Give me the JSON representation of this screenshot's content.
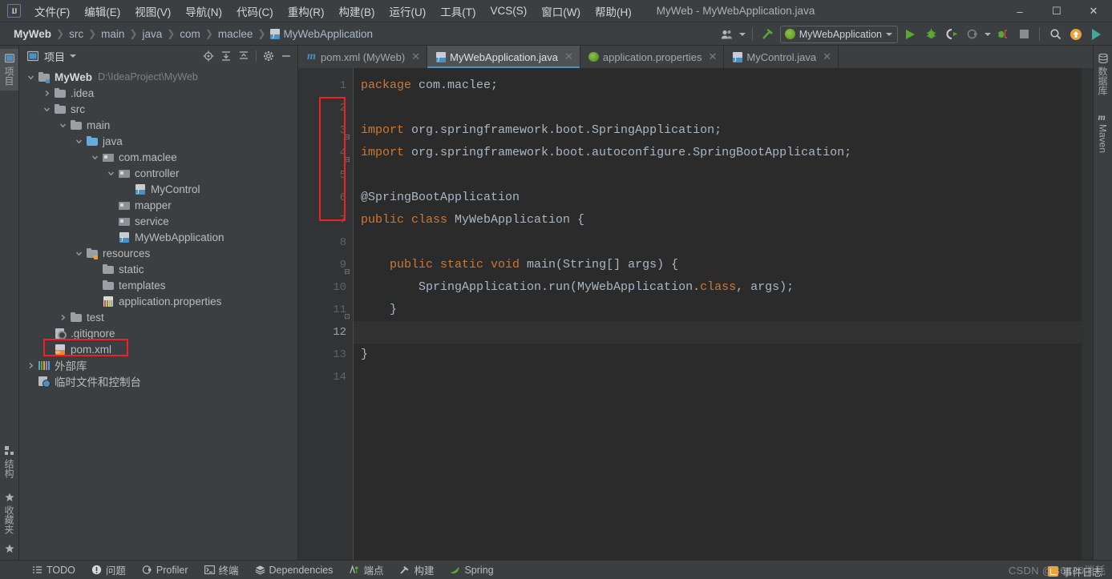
{
  "window": {
    "title": "MyWeb - MyWebApplication.java",
    "logo": "IJ",
    "controls": {
      "minimize": "–",
      "maximize": "☐",
      "close": "✕"
    }
  },
  "menubar": [
    {
      "label": "文件(F)",
      "name": "menu-file"
    },
    {
      "label": "编辑(E)",
      "name": "menu-edit"
    },
    {
      "label": "视图(V)",
      "name": "menu-view"
    },
    {
      "label": "导航(N)",
      "name": "menu-navigate"
    },
    {
      "label": "代码(C)",
      "name": "menu-code"
    },
    {
      "label": "重构(R)",
      "name": "menu-refactor"
    },
    {
      "label": "构建(B)",
      "name": "menu-build"
    },
    {
      "label": "运行(U)",
      "name": "menu-run"
    },
    {
      "label": "工具(T)",
      "name": "menu-tools"
    },
    {
      "label": "VCS(S)",
      "name": "menu-vcs"
    },
    {
      "label": "窗口(W)",
      "name": "menu-window"
    },
    {
      "label": "帮助(H)",
      "name": "menu-help"
    }
  ],
  "breadcrumb": [
    "MyWeb",
    "src",
    "main",
    "java",
    "com",
    "maclee",
    "MyWebApplication"
  ],
  "toolbar": {
    "run_config": "MyWebApplication",
    "buttons": [
      "run",
      "debug",
      "run-with-coverage",
      "profile",
      "stop-gutter",
      "stop"
    ]
  },
  "project_panel": {
    "title": "项目",
    "tree": [
      {
        "indent": 0,
        "arrow": "down",
        "icon": "folder mod",
        "label": "MyWeb",
        "bold": true,
        "sub": "D:\\IdeaProject\\MyWeb",
        "name": "tree-node-myweb"
      },
      {
        "indent": 1,
        "arrow": "right",
        "icon": "folder",
        "label": ".idea",
        "name": "tree-node-idea"
      },
      {
        "indent": 1,
        "arrow": "down",
        "icon": "folder",
        "label": "src",
        "name": "tree-node-src"
      },
      {
        "indent": 2,
        "arrow": "down",
        "icon": "folder",
        "label": "main",
        "name": "tree-node-main"
      },
      {
        "indent": 3,
        "arrow": "down",
        "icon": "folder src",
        "label": "java",
        "name": "tree-node-java"
      },
      {
        "indent": 4,
        "arrow": "down",
        "icon": "pkg",
        "label": "com.maclee",
        "name": "tree-node-com-maclee"
      },
      {
        "indent": 5,
        "arrow": "down",
        "icon": "pkg",
        "label": "controller",
        "name": "tree-node-controller"
      },
      {
        "indent": 6,
        "arrow": "none",
        "icon": "java",
        "label": "MyControl",
        "name": "tree-node-mycontrol"
      },
      {
        "indent": 5,
        "arrow": "none",
        "icon": "pkg",
        "label": "mapper",
        "name": "tree-node-mapper"
      },
      {
        "indent": 5,
        "arrow": "none",
        "icon": "pkg",
        "label": "service",
        "name": "tree-node-service"
      },
      {
        "indent": 5,
        "arrow": "none",
        "icon": "java",
        "label": "MyWebApplication",
        "name": "tree-node-mywebapplication"
      },
      {
        "indent": 3,
        "arrow": "down",
        "icon": "folder res",
        "label": "resources",
        "name": "tree-node-resources"
      },
      {
        "indent": 4,
        "arrow": "none",
        "icon": "folder",
        "label": "static",
        "name": "tree-node-static"
      },
      {
        "indent": 4,
        "arrow": "none",
        "icon": "folder",
        "label": "templates",
        "name": "tree-node-templates"
      },
      {
        "indent": 4,
        "arrow": "none",
        "icon": "props",
        "label": "application.properties",
        "name": "tree-node-application-properties"
      },
      {
        "indent": 2,
        "arrow": "right",
        "icon": "folder",
        "label": "test",
        "name": "tree-node-test"
      },
      {
        "indent": 1,
        "arrow": "none",
        "icon": "git",
        "label": ".gitignore",
        "name": "tree-node-gitignore"
      },
      {
        "indent": 1,
        "arrow": "none",
        "icon": "xml",
        "label": "pom.xml",
        "name": "tree-node-pom-xml",
        "highlight": true
      },
      {
        "indent": 0,
        "arrow": "right",
        "icon": "lib",
        "label": "外部库",
        "name": "tree-node-external-libraries"
      },
      {
        "indent": 0,
        "arrow": "none",
        "icon": "scratch",
        "label": "临时文件和控制台",
        "name": "tree-node-scratches"
      }
    ]
  },
  "editor": {
    "tabs": [
      {
        "label": "pom.xml (MyWeb)",
        "icon": "m",
        "active": false,
        "name": "tab-pom-xml"
      },
      {
        "label": "MyWebApplication.java",
        "icon": "j",
        "active": true,
        "name": "tab-mywebapplication-java"
      },
      {
        "label": "application.properties",
        "icon": "spr",
        "active": false,
        "name": "tab-application-properties"
      },
      {
        "label": "MyControl.java",
        "icon": "j",
        "active": false,
        "name": "tab-mycontrol-java"
      }
    ],
    "line_numbers": [
      "1",
      "2",
      "3",
      "4",
      "5",
      "6",
      "7",
      "8",
      "9",
      "10",
      "11",
      "12",
      "13",
      "14"
    ],
    "current_line": 12,
    "code_lines": [
      {
        "n": 1,
        "html": "<span class='k'>package</span> com.maclee;"
      },
      {
        "n": 2,
        "html": ""
      },
      {
        "n": 3,
        "html": "<span class='k'>import</span> org.springframework.boot.SpringApplication;"
      },
      {
        "n": 4,
        "html": "<span class='k'>import</span> org.springframework.boot.autoconfigure.SpringBootApplication;"
      },
      {
        "n": 5,
        "html": ""
      },
      {
        "n": 6,
        "html": "@SpringBootApplication"
      },
      {
        "n": 7,
        "html": "<span class='k'>public class</span> MyWebApplication {"
      },
      {
        "n": 8,
        "html": ""
      },
      {
        "n": 9,
        "html": "    <span class='k'>public static void</span> main(String[] args) {"
      },
      {
        "n": 10,
        "html": "        SpringApplication.run(MyWebApplication.<span class='k'>class</span>, args);"
      },
      {
        "n": 11,
        "html": "    }"
      },
      {
        "n": 12,
        "html": ""
      },
      {
        "n": 13,
        "html": "}"
      },
      {
        "n": 14,
        "html": ""
      }
    ],
    "plain_code": [
      "package com.maclee;",
      "",
      "import org.springframework.boot.SpringApplication;",
      "import org.springframework.boot.autoconfigure.SpringBootApplication;",
      "",
      "@SpringBootApplication",
      "public class MyWebApplication {",
      "",
      "    public static void main(String[] args) {",
      "        SpringApplication.run(MyWebApplication.class, args);",
      "    }",
      "",
      "}",
      ""
    ]
  },
  "left_stripe": {
    "top": [
      {
        "label": "项目",
        "name": "stripe-project"
      }
    ],
    "bottom": [
      {
        "label": "结构",
        "name": "stripe-structure"
      },
      {
        "label": "收藏夹",
        "name": "stripe-favorites"
      }
    ]
  },
  "right_stripe": {
    "top": [
      {
        "label": "数据库",
        "name": "stripe-database"
      },
      {
        "label": "Maven",
        "name": "stripe-maven"
      }
    ]
  },
  "statusbar": {
    "items": [
      {
        "label": "TODO",
        "icon": "list-icon",
        "name": "status-todo"
      },
      {
        "label": "问题",
        "icon": "warning-icon",
        "name": "status-problems"
      },
      {
        "label": "Profiler",
        "icon": "profiler-icon",
        "name": "status-profiler"
      },
      {
        "label": "终端",
        "icon": "terminal-icon",
        "name": "status-terminal"
      },
      {
        "label": "Dependencies",
        "icon": "layers-icon",
        "name": "status-dependencies"
      },
      {
        "label": "端点",
        "icon": "endpoints-icon",
        "name": "status-endpoints"
      },
      {
        "label": "构建",
        "icon": "hammer-icon",
        "name": "status-build"
      },
      {
        "label": "Spring",
        "icon": "spring-leaf-icon",
        "name": "status-spring"
      }
    ],
    "event_log": "事件日志",
    "watermark": "CSDN @B6420消耗"
  },
  "colors": {
    "accent": "#4a90c4",
    "keyword": "#cc7832",
    "highlight_box": "#ee2222",
    "panel_bg": "#3c3f41",
    "editor_bg": "#2b2b2b",
    "gutter_bg": "#313335"
  }
}
